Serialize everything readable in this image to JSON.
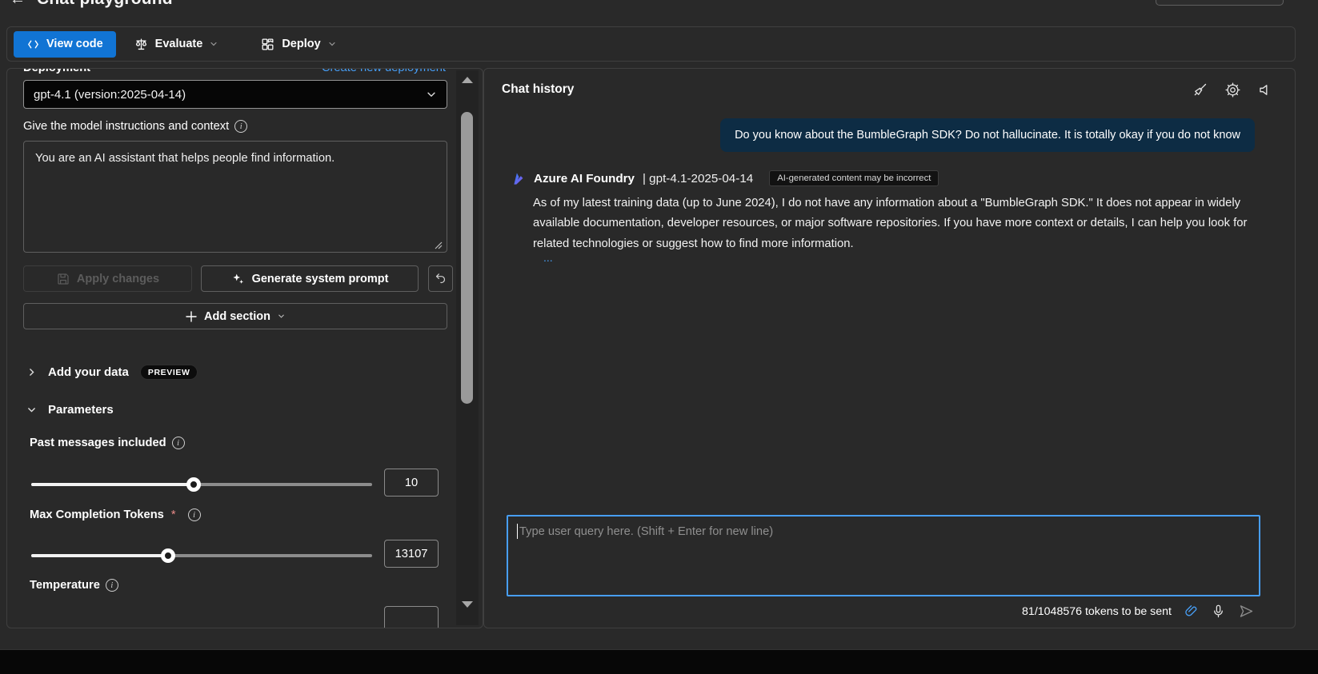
{
  "page": {
    "title": "Chat playground",
    "back_icon": "arrow-left"
  },
  "toolbar": {
    "view_code_label": "View code",
    "evaluate_label": "Evaluate",
    "deploy_label": "Deploy"
  },
  "left": {
    "deployment_label": "Deployment",
    "create_new_deployment": "Create new deployment",
    "deployment_value": "gpt-4.1 (version:2025-04-14)",
    "instructions_label": "Give the model instructions and context",
    "instructions_value": "You are an AI assistant that helps people find information.",
    "apply_changes_label": "Apply changes",
    "generate_prompt_label": "Generate system prompt",
    "add_section_label": "Add section",
    "add_your_data_label": "Add your data",
    "preview_badge": "PREVIEW",
    "parameters_label": "Parameters",
    "past_messages": {
      "label": "Past messages included",
      "value": "10",
      "percent": 47.7
    },
    "max_tokens": {
      "label": "Max Completion Tokens",
      "required_mark": "*",
      "value": "13107",
      "percent": 40.1
    },
    "temperature_label": "Temperature"
  },
  "chat": {
    "header": "Chat history",
    "user_message": "Do you know about the BumbleGraph SDK? Do not hallucinate. It is totally okay if you do not know",
    "assistant_name": "Azure AI Foundry",
    "assistant_model": "| gpt-4.1-2025-04-14",
    "disclaimer": "AI-generated content may be incorrect",
    "assistant_message": "As of my latest training data (up to June 2024), I do not have any information about a \"BumbleGraph SDK.\" It does not appear in widely available documentation, developer resources, or major software repositories. If you have more context or details, I can help you look for related technologies or suggest how to find more information.",
    "ellipsis": "...",
    "input_placeholder": "Type user query here. (Shift + Enter for new line)",
    "tokens_text": "81/1048576 tokens to be sent"
  },
  "colors": {
    "background": "#292929",
    "primary_button": "#1174d4",
    "accent_blue": "#479ef5",
    "user_bubble": "#0d2c44",
    "panel_border": "#3f3f3f"
  }
}
